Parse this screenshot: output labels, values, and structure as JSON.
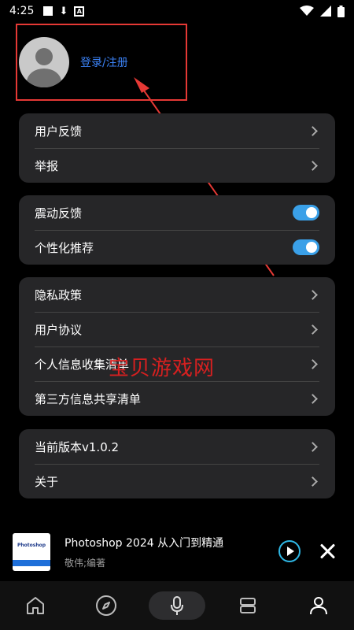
{
  "status_bar": {
    "time": "4:25"
  },
  "profile": {
    "login_label": "登录/注册"
  },
  "watermark": "宝贝游戏网",
  "cards": {
    "group1": [
      {
        "label": "用户反馈"
      },
      {
        "label": "举报"
      }
    ],
    "group2": [
      {
        "label": "震动反馈",
        "enabled": true
      },
      {
        "label": "个性化推荐",
        "enabled": true
      }
    ],
    "group3": [
      {
        "label": "隐私政策"
      },
      {
        "label": "用户协议"
      },
      {
        "label": "个人信息收集清单"
      },
      {
        "label": "第三方信息共享清单"
      }
    ],
    "group4": [
      {
        "label": "当前版本v1.0.2"
      },
      {
        "label": "关于"
      }
    ]
  },
  "now_playing": {
    "title": "Photoshop 2024 从入门到精通",
    "author": "敬伟;编著",
    "cover_text": "Photoshop"
  },
  "bottom_nav": {
    "items": [
      "home-icon",
      "compass-icon",
      "mic-icon",
      "library-icon",
      "profile-icon"
    ],
    "active": "profile-icon"
  },
  "colors": {
    "accent": "#3b82f6",
    "toggle": "#3aa0e8",
    "card_bg": "#262628",
    "highlight_red": "#e53935",
    "play_ring": "#2fb8e6"
  }
}
